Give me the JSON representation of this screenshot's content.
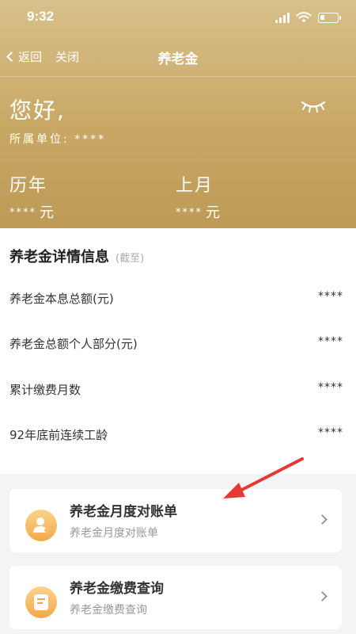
{
  "status": {
    "time": "9:32"
  },
  "nav": {
    "back_label": "返回",
    "close_label": "关闭",
    "title": "养老金"
  },
  "hero": {
    "greeting": "您好,",
    "unit_label": "所属单位:",
    "unit_value": "****",
    "stats": [
      {
        "label": "历年",
        "value": "****",
        "unit": "元"
      },
      {
        "label": "上月",
        "value": "****",
        "unit": "元"
      }
    ]
  },
  "details": {
    "title": "养老金详情信息",
    "subtitle": "(截至)",
    "rows": [
      {
        "label": "养老金本息总额(元)",
        "value": "****"
      },
      {
        "label": "养老金总额个人部分(元)",
        "value": "****"
      },
      {
        "label": "累计缴费月数",
        "value": "****"
      },
      {
        "label": "92年底前连续工龄",
        "value": "****"
      }
    ]
  },
  "cards": [
    {
      "title": "养老金月度对账单",
      "subtitle": "养老金月度对账单",
      "icon": "person-icon"
    },
    {
      "title": "养老金缴费查询",
      "subtitle": "养老金缴费查询",
      "icon": "document-icon"
    }
  ],
  "colors": {
    "hero_gold": "#c9a866",
    "card_icon_orange": "#f3a84a",
    "annotation_arrow": "#e53935"
  }
}
